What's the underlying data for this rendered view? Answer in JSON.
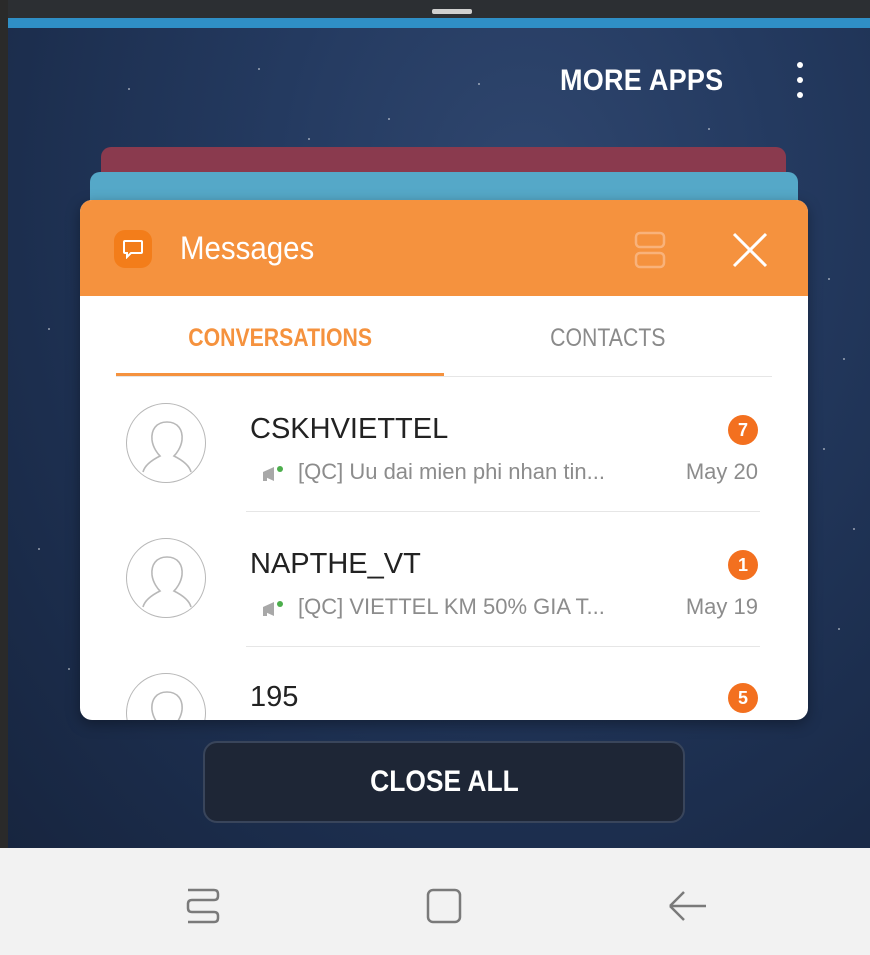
{
  "header": {
    "more_apps_label": "MORE APPS",
    "overflow_menu_icon": "more-vert-icon"
  },
  "card": {
    "app_title": "Messages",
    "app_icon": "chat-bubble-icon",
    "split_view_icon": "split-screen-icon",
    "close_icon": "close-icon"
  },
  "tabs": [
    {
      "label": "CONVERSATIONS",
      "active": true
    },
    {
      "label": "CONTACTS",
      "active": false
    }
  ],
  "conversations": [
    {
      "name": "CSKHVIETTEL",
      "preview": "[QC] Uu dai mien phi nhan tin...",
      "date": "May 20",
      "unread": "7"
    },
    {
      "name": "NAPTHE_VT",
      "preview": "[QC] VIETTEL KM 50% GIA T...",
      "date": "May 19",
      "unread": "1"
    },
    {
      "name": "195",
      "preview": "",
      "date": "",
      "unread": "5"
    }
  ],
  "close_all_label": "CLOSE ALL",
  "navbar": {
    "recents_icon": "recent-apps-icon",
    "home_icon": "home-icon",
    "back_icon": "back-arrow-icon"
  },
  "colors": {
    "accent": "#f5923e",
    "badge": "#f3701f",
    "background_top": "#2f466e"
  }
}
